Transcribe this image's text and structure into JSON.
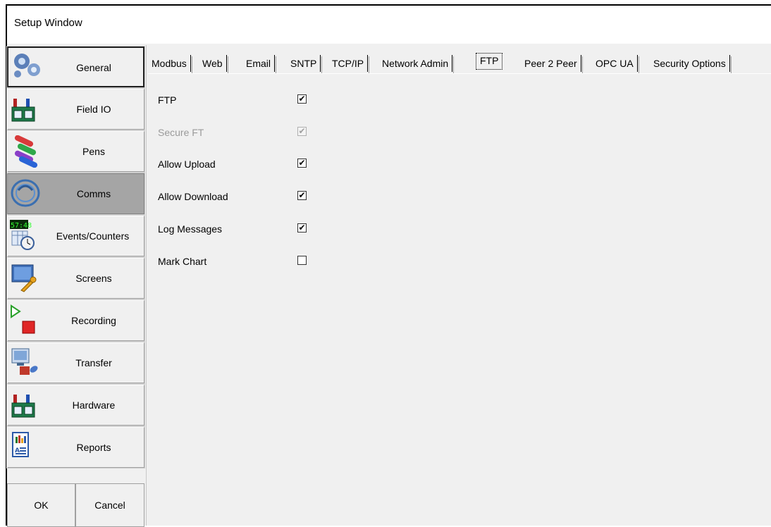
{
  "window": {
    "title": "Setup Window"
  },
  "sidebar": {
    "items": [
      {
        "label": "General",
        "icon": "gears-icon"
      },
      {
        "label": "Field IO",
        "icon": "io-module-icon"
      },
      {
        "label": "Pens",
        "icon": "pens-icon"
      },
      {
        "label": "Comms",
        "icon": "comms-icon",
        "active": true
      },
      {
        "label": "Events/Counters",
        "icon": "clock-counter-icon",
        "clock_text": "57:48"
      },
      {
        "label": "Screens",
        "icon": "screen-wrench-icon"
      },
      {
        "label": "Recording",
        "icon": "play-stop-icon"
      },
      {
        "label": "Transfer",
        "icon": "transfer-icon"
      },
      {
        "label": "Hardware",
        "icon": "io-module-icon"
      },
      {
        "label": "Reports",
        "icon": "report-icon"
      }
    ],
    "ok_label": "OK",
    "cancel_label": "Cancel"
  },
  "tabs": [
    {
      "label": "Modbus"
    },
    {
      "label": "Web"
    },
    {
      "label": "Email"
    },
    {
      "label": "SNTP"
    },
    {
      "label": "TCP/IP"
    },
    {
      "label": "Network Admin"
    },
    {
      "label": "FTP",
      "active": true
    },
    {
      "label": "Peer 2 Peer"
    },
    {
      "label": "OPC UA"
    },
    {
      "label": "Security Options"
    }
  ],
  "ftp": {
    "options": [
      {
        "label": "FTP",
        "checked": true,
        "enabled": true
      },
      {
        "label": "Secure FT",
        "checked": true,
        "enabled": false
      },
      {
        "label": "Allow Upload",
        "checked": true,
        "enabled": true
      },
      {
        "label": "Allow Download",
        "checked": true,
        "enabled": true
      },
      {
        "label": "Log Messages",
        "checked": true,
        "enabled": true
      },
      {
        "label": "Mark Chart",
        "checked": false,
        "enabled": true
      }
    ]
  },
  "colors": {
    "active_nav": "#a5a5a5",
    "background": "#f0f0f0"
  }
}
